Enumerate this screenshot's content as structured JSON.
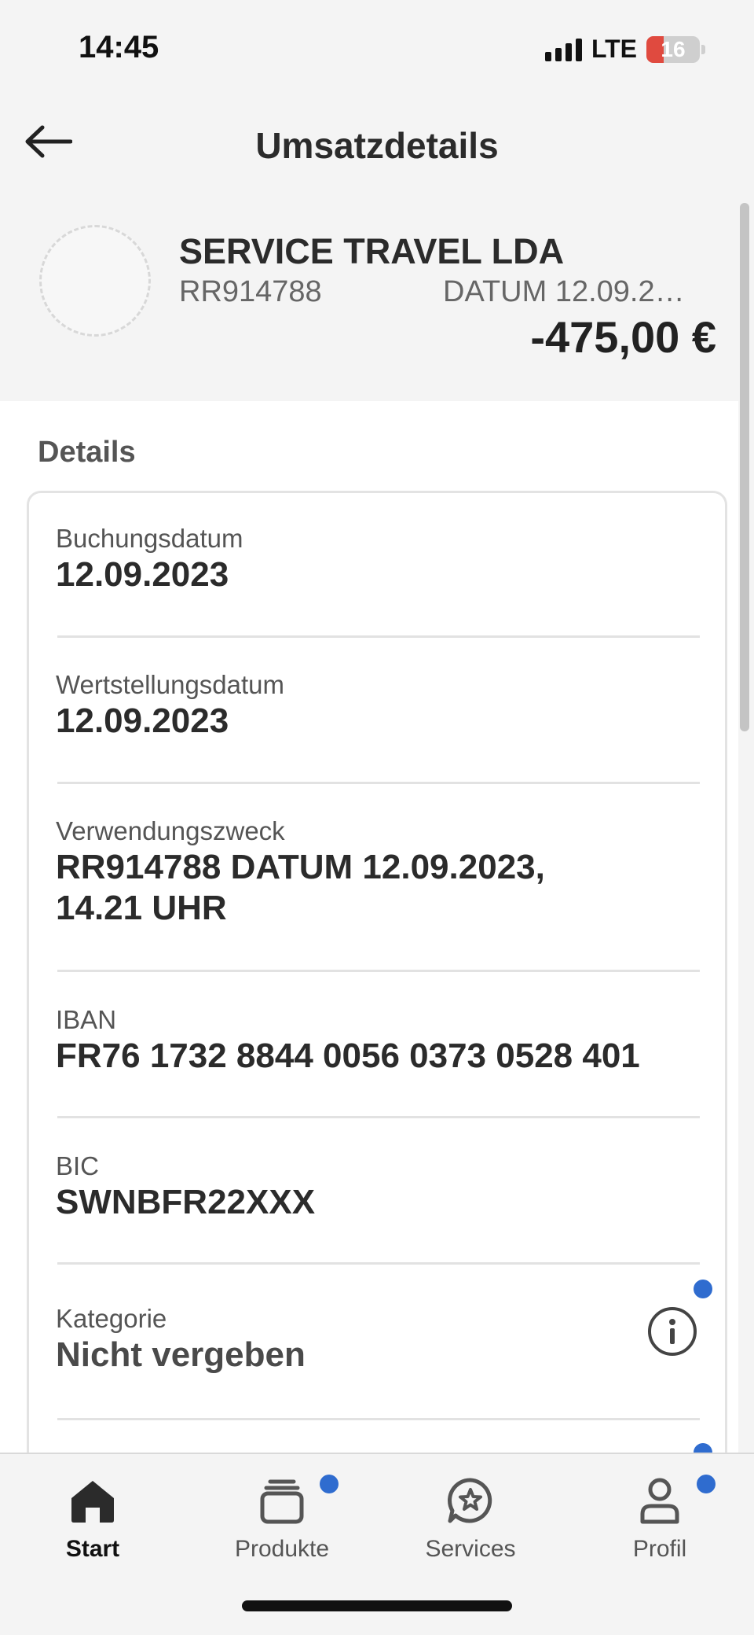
{
  "status_bar": {
    "time": "14:45",
    "network": "LTE",
    "battery_level": "16",
    "battery_color": "#e04a3f"
  },
  "header": {
    "back_icon": "arrow-left-icon",
    "title": "Umsatzdetails"
  },
  "transaction": {
    "merchant": "SERVICE TRAVEL LDA",
    "reference": "RR914788",
    "date_preview": "DATUM 12.09.2…",
    "amount": "-475,00 €"
  },
  "details": {
    "section_title": "Details",
    "rows": [
      {
        "label": "Buchungsdatum",
        "value": "12.09.2023"
      },
      {
        "label": "Wertstellungsdatum",
        "value": "12.09.2023"
      },
      {
        "label": "Verwendungszweck",
        "value_line1": "RR914788 DATUM 12.09.2023,",
        "value_line2": "14.21 UHR"
      },
      {
        "label": "IBAN",
        "value": "FR76 1732 8844 0056 0373 0528 401"
      },
      {
        "label": "BIC",
        "value": "SWNBFR22XXX"
      },
      {
        "label": "Kategorie",
        "value": "Nicht vergeben",
        "icon": "info-icon"
      }
    ]
  },
  "bottom_nav": {
    "items": [
      {
        "label": "Start",
        "icon": "home-icon",
        "active": true
      },
      {
        "label": "Produkte",
        "icon": "stack-icon",
        "badge": true
      },
      {
        "label": "Services",
        "icon": "star-chat-icon"
      },
      {
        "label": "Profil",
        "icon": "person-icon",
        "badge": true
      }
    ]
  },
  "colors": {
    "accent_badge": "#2f6ccf",
    "background": "#f4f4f4",
    "card": "#ffffff"
  }
}
